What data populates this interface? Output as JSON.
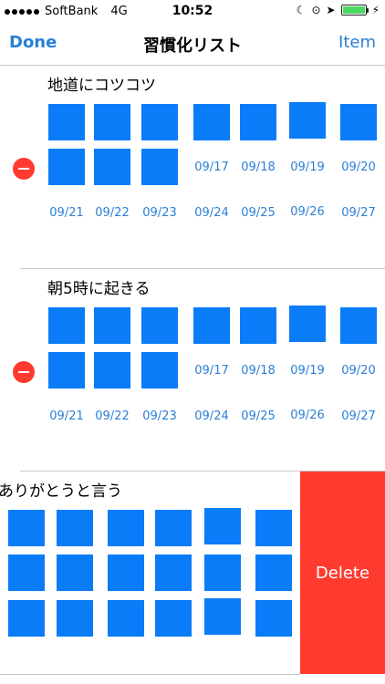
{
  "status_bar": {
    "carrier": "SoftBank",
    "network": "4G",
    "time": "10:52",
    "battery_color": "#4cd964"
  },
  "nav": {
    "done_label": "Done",
    "title": "習慣化リスト",
    "item_label": "Item"
  },
  "habits": [
    {
      "title": "地道にコツコツ",
      "row2_dates": [
        "09/17",
        "09/18",
        "09/19",
        "09/20"
      ],
      "row3_dates": [
        "09/21",
        "09/22",
        "09/23",
        "09/24",
        "09/25",
        "09/26",
        "09/27"
      ]
    },
    {
      "title": "朝5時に起きる",
      "row2_dates": [
        "09/17",
        "09/18",
        "09/19",
        "09/20"
      ],
      "row3_dates": [
        "09/21",
        "09/22",
        "09/23",
        "09/24",
        "09/25",
        "09/26",
        "09/27"
      ]
    },
    {
      "title": "ありがとうと言う"
    }
  ],
  "delete_label": "Delete",
  "colors": {
    "accent": "#2a7fd6",
    "square": "#0a7cf8",
    "destructive": "#ff3b30"
  }
}
